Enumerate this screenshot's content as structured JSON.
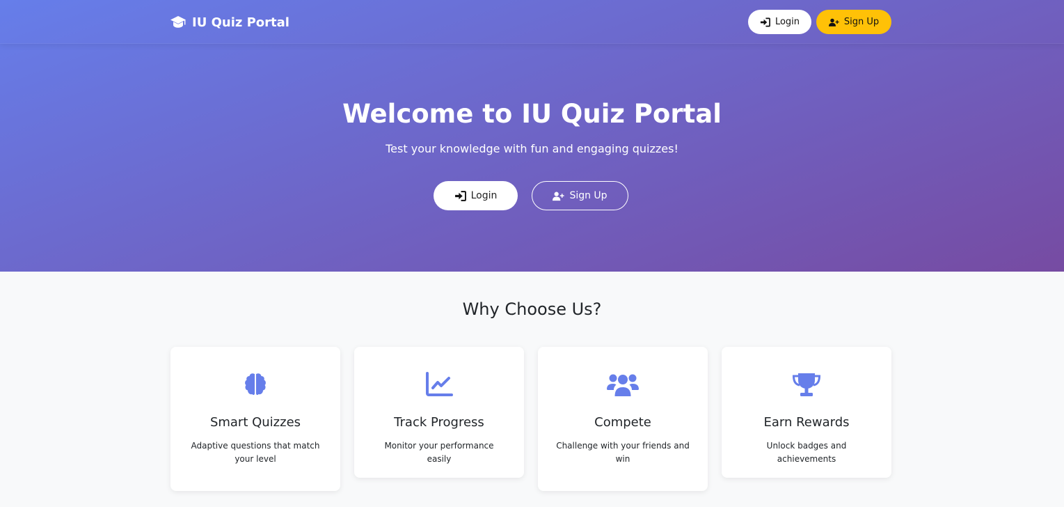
{
  "colors": {
    "accent": "#667eea",
    "gradient_start": "#667eea",
    "gradient_end": "#764ba2",
    "signup_yellow": "#ffc107",
    "page_bg": "#f8f9fa"
  },
  "navbar": {
    "brand": "IU Quiz Portal",
    "brand_icon": "graduation-cap-icon",
    "login_label": "Login",
    "signup_label": "Sign Up"
  },
  "hero": {
    "title": "Welcome to IU Quiz Portal",
    "subtitle": "Test your knowledge with fun and engaging quizzes!",
    "login_label": "Login",
    "signup_label": "Sign Up"
  },
  "features": {
    "title": "Why Choose Us?",
    "cards": [
      {
        "icon": "brain-icon",
        "title": "Smart Quizzes",
        "text": "Adaptive questions that match your level"
      },
      {
        "icon": "chart-line-icon",
        "title": "Track Progress",
        "text": "Monitor your performance easily"
      },
      {
        "icon": "users-icon",
        "title": "Compete",
        "text": "Challenge with your friends and win"
      },
      {
        "icon": "trophy-icon",
        "title": "Earn Rewards",
        "text": "Unlock badges and achievements"
      }
    ]
  }
}
